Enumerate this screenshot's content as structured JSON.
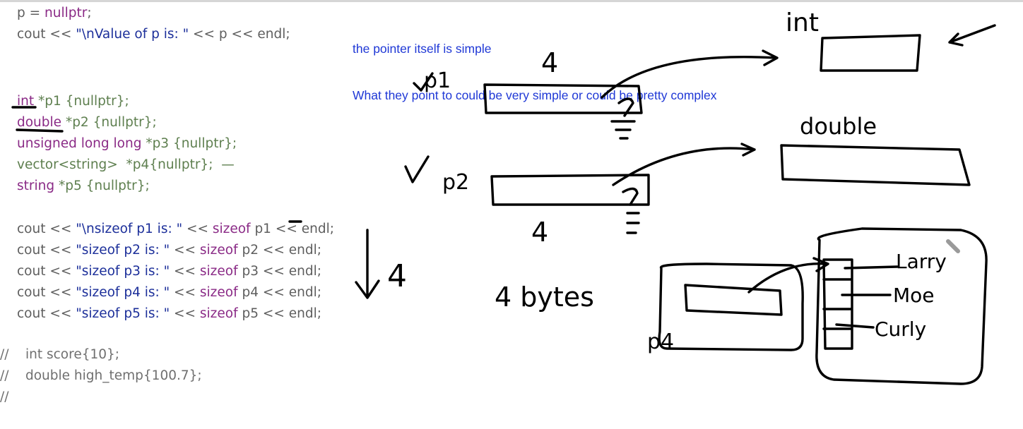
{
  "code": {
    "l1": {
      "a": "p = ",
      "b": "nullptr",
      ";": ";"
    },
    "l2": {
      "a": "cout << ",
      "b": "\"\\nValue of p is: \"",
      "c": " << p << endl;"
    },
    "l3": {
      "a": "int",
      " b": " *p1 {nullptr};"
    },
    "l4": {
      "a": "double",
      "b": " *p2 {nullptr};"
    },
    "l5": {
      "a": "unsigned long long",
      "b": " *p3 {nullptr};"
    },
    "l6": {
      "a": "vector<string>",
      "b": "  *p4{nullptr};  —"
    },
    "l7": {
      "a": "string",
      "b": " *p5 {nullptr};"
    },
    "l8": {
      "a": "cout << ",
      "b": "\"\\nsizeof p1 is: \"",
      "c": " << ",
      "d": "sizeof",
      "e": " p1 << endl;"
    },
    "l9": {
      "a": "cout << ",
      "b": "\"sizeof p2 is: \"",
      "c": " << ",
      "d": "sizeof",
      "e": " p2 << endl;"
    },
    "l10": {
      "a": "cout << ",
      "b": "\"sizeof p3 is: \"",
      "c": " << ",
      "d": "sizeof",
      "e": " p3 << endl;"
    },
    "l11": {
      "a": "cout << ",
      "b": "\"sizeof p4 is: \"",
      "c": " << ",
      "d": "sizeof",
      "e": " p4 << endl;"
    },
    "l12": {
      "a": "cout << ",
      "b": "\"sizeof p5 is: \"",
      "c": " << ",
      "d": "sizeof",
      "e": " p5 << endl;"
    },
    "c1": "//    int score{10};",
    "c2": "//    double high_temp{100.7};",
    "c3": "//"
  },
  "annotation": {
    "line1": "the pointer itself is simple",
    "line2": "What they point to could be very simple or could be pretty complex"
  },
  "handwriting": {
    "p1": "p1",
    "p2": "p2",
    "p4": "p4",
    "size_top": "4",
    "size_mid": "4",
    "size_arrow": "4",
    "bytes": "4 bytes",
    "int": "int",
    "double": "double",
    "names": [
      "Larry",
      "Moe",
      "Curly"
    ]
  },
  "colors": {
    "keyword": "#8a2a86",
    "string": "#1c2f9a",
    "identifier": "#5e7f4f",
    "annotation": "#1f38d6"
  }
}
